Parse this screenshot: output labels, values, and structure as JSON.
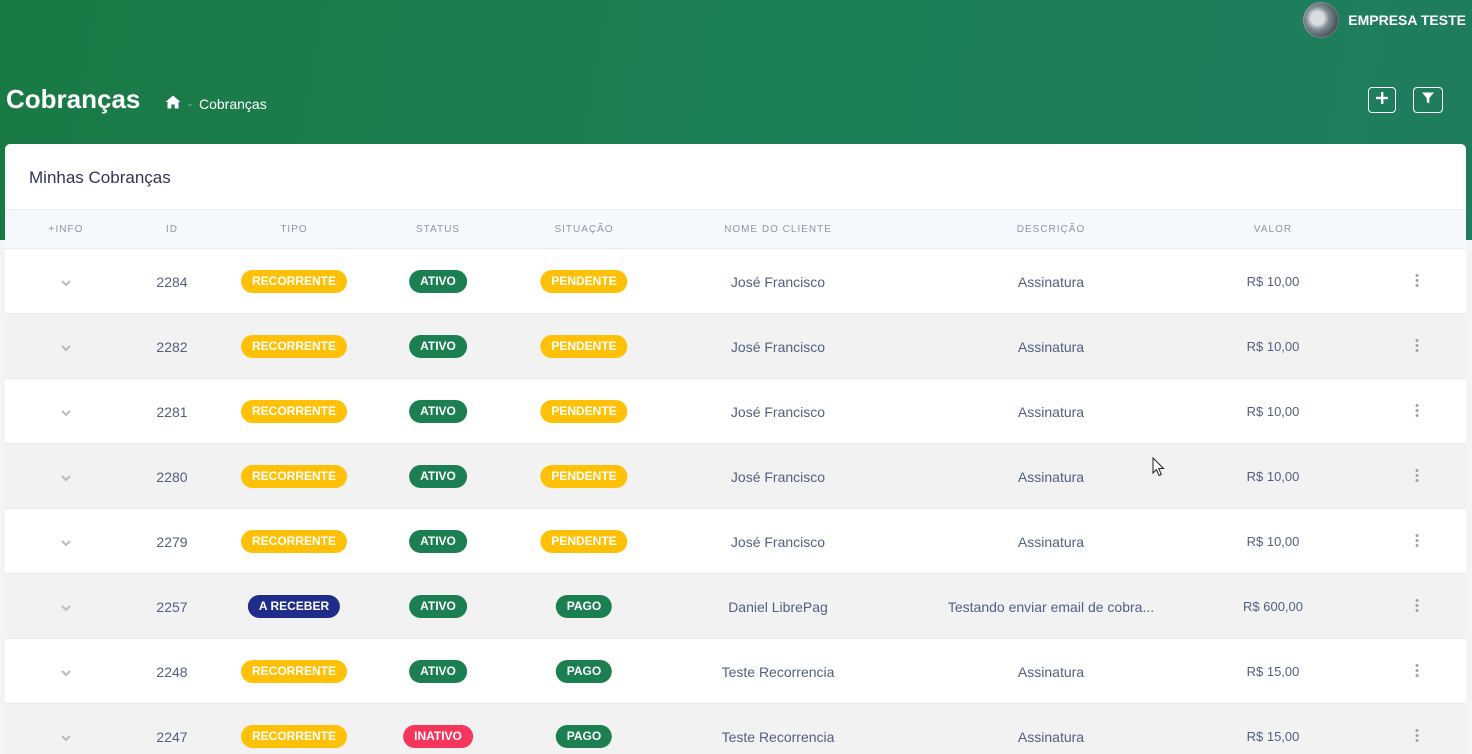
{
  "header": {
    "user_name": "EMPRESA TESTE",
    "page_title": "Cobranças",
    "breadcrumb": [
      "Cobranças"
    ],
    "add_button_icon": "plus-icon",
    "filter_button_icon": "filter-icon"
  },
  "card": {
    "title": "Minhas Cobranças"
  },
  "table": {
    "columns": [
      "+INFO",
      "ID",
      "TIPO",
      "STATUS",
      "SITUAÇÃO",
      "NOME DO CLIENTE",
      "DESCRIÇÃO",
      "VALOR"
    ],
    "rows": [
      {
        "id": "2284",
        "tipo": "RECORRENTE",
        "status": "ATIVO",
        "situacao": "PENDENTE",
        "cliente": "José Francisco",
        "descricao": "Assinatura",
        "valor": "R$ 10,00"
      },
      {
        "id": "2282",
        "tipo": "RECORRENTE",
        "status": "ATIVO",
        "situacao": "PENDENTE",
        "cliente": "José Francisco",
        "descricao": "Assinatura",
        "valor": "R$ 10,00"
      },
      {
        "id": "2281",
        "tipo": "RECORRENTE",
        "status": "ATIVO",
        "situacao": "PENDENTE",
        "cliente": "José Francisco",
        "descricao": "Assinatura",
        "valor": "R$ 10,00"
      },
      {
        "id": "2280",
        "tipo": "RECORRENTE",
        "status": "ATIVO",
        "situacao": "PENDENTE",
        "cliente": "José Francisco",
        "descricao": "Assinatura",
        "valor": "R$ 10,00"
      },
      {
        "id": "2279",
        "tipo": "RECORRENTE",
        "status": "ATIVO",
        "situacao": "PENDENTE",
        "cliente": "José Francisco",
        "descricao": "Assinatura",
        "valor": "R$ 10,00"
      },
      {
        "id": "2257",
        "tipo": "A RECEBER",
        "status": "ATIVO",
        "situacao": "PAGO",
        "cliente": "Daniel LibrePag",
        "descricao": "Testando enviar email de cobra...",
        "valor": "R$ 600,00"
      },
      {
        "id": "2248",
        "tipo": "RECORRENTE",
        "status": "ATIVO",
        "situacao": "PAGO",
        "cliente": "Teste Recorrencia",
        "descricao": "Assinatura",
        "valor": "R$ 15,00"
      },
      {
        "id": "2247",
        "tipo": "RECORRENTE",
        "status": "INATIVO",
        "situacao": "PAGO",
        "cliente": "Teste Recorrencia",
        "descricao": "Assinatura",
        "valor": "R$ 15,00"
      }
    ]
  },
  "colors": {
    "header_green": "#1a7a45",
    "badge_yellow": "#ffc107",
    "badge_green": "#1b7f52",
    "badge_blue": "#1f2c8a",
    "badge_red": "#f5365c"
  }
}
